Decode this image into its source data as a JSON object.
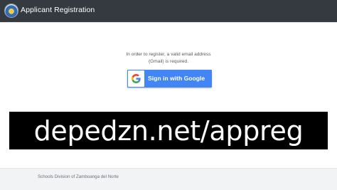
{
  "header": {
    "logo_icon": "division-seal-icon",
    "title": "Applicant Registration",
    "bg_color": "#343a40"
  },
  "main": {
    "notice_line1": "In order to register, a valid email address",
    "notice_line2": "(Gmail) is required.",
    "google_button": {
      "icon": "google-g-icon",
      "label": "Sign in with Google",
      "color": "#4285f4"
    }
  },
  "banner": {
    "text": "depedzn.net/appreg"
  },
  "footer": {
    "text": "Schools Division of Zamboanga del Norte"
  }
}
